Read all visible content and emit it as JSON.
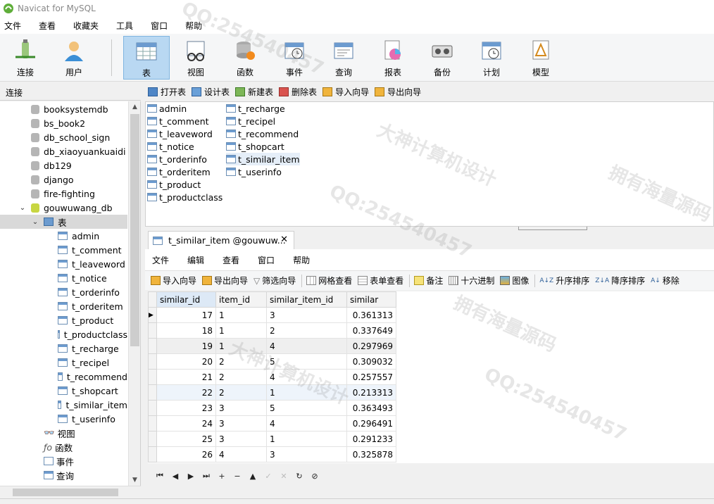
{
  "window": {
    "title": "Navicat for MySQL"
  },
  "menu": [
    "文件",
    "查看",
    "收藏夹",
    "工具",
    "窗口",
    "帮助"
  ],
  "toolbar": [
    {
      "label": "连接",
      "icon": "connect-icon"
    },
    {
      "label": "用户",
      "icon": "user-icon"
    },
    {
      "label": "表",
      "icon": "table-icon",
      "active": true
    },
    {
      "label": "视图",
      "icon": "view-icon"
    },
    {
      "label": "函数",
      "icon": "function-icon"
    },
    {
      "label": "事件",
      "icon": "event-icon"
    },
    {
      "label": "查询",
      "icon": "query-icon"
    },
    {
      "label": "报表",
      "icon": "report-icon"
    },
    {
      "label": "备份",
      "icon": "backup-icon"
    },
    {
      "label": "计划",
      "icon": "schedule-icon"
    },
    {
      "label": "模型",
      "icon": "model-icon"
    }
  ],
  "connection_header": "连接",
  "object_toolbar": [
    "打开表",
    "设计表",
    "新建表",
    "删除表",
    "导入向导",
    "导出向导"
  ],
  "tree": {
    "databases": [
      "booksystemdb",
      "bs_book2",
      "db_school_sign",
      "db_xiaoyuankuaidi",
      "db129",
      "django",
      "fire-fighting",
      "gouwuwang_db"
    ],
    "tables_node": "表",
    "tables": [
      "admin",
      "t_comment",
      "t_leaveword",
      "t_notice",
      "t_orderinfo",
      "t_orderitem",
      "t_product",
      "t_productclass",
      "t_recharge",
      "t_recipel",
      "t_recommend",
      "t_shopcart",
      "t_similar_item",
      "t_userinfo"
    ],
    "other_nodes": [
      "视图",
      "函数",
      "事件",
      "查询"
    ]
  },
  "object_list": {
    "col1": [
      "admin",
      "t_comment",
      "t_leaveword",
      "t_notice",
      "t_orderinfo",
      "t_orderitem",
      "t_product",
      "t_productclass"
    ],
    "col2": [
      "t_recharge",
      "t_recipel",
      "t_recommend",
      "t_shopcart",
      "t_similar_item",
      "t_userinfo"
    ],
    "highlighted": "t_similar_item"
  },
  "tab": {
    "label": "t_similar_item @gouwuw...",
    "close": "✕"
  },
  "table_menu": [
    "文件",
    "编辑",
    "查看",
    "窗口",
    "帮助"
  ],
  "data_toolbar": [
    "导入向导",
    "导出向导",
    "筛选向导",
    "网格查看",
    "表单查看",
    "备注",
    "十六进制",
    "图像",
    "升序排序",
    "降序排序",
    "移除"
  ],
  "grid": {
    "columns": [
      "similar_id",
      "item_id",
      "similar_item_id",
      "similar"
    ],
    "rows": [
      [
        "17",
        "1",
        "3",
        "0.361313"
      ],
      [
        "18",
        "1",
        "2",
        "0.337649"
      ],
      [
        "19",
        "1",
        "4",
        "0.297969"
      ],
      [
        "20",
        "2",
        "5",
        "0.309032"
      ],
      [
        "21",
        "2",
        "4",
        "0.257557"
      ],
      [
        "22",
        "2",
        "1",
        "0.213313"
      ],
      [
        "23",
        "3",
        "5",
        "0.363493"
      ],
      [
        "24",
        "3",
        "4",
        "0.296491"
      ],
      [
        "25",
        "3",
        "1",
        "0.291233"
      ],
      [
        "26",
        "4",
        "3",
        "0.325878"
      ]
    ]
  },
  "nav": [
    "⏮",
    "◀",
    "▶",
    "⏭",
    "+",
    "−",
    "▲",
    "✓",
    "✕",
    "↻",
    "⊘"
  ],
  "watermarks": [
    "QQ:254540457",
    "大神计算机设计",
    "拥有海量源码"
  ]
}
